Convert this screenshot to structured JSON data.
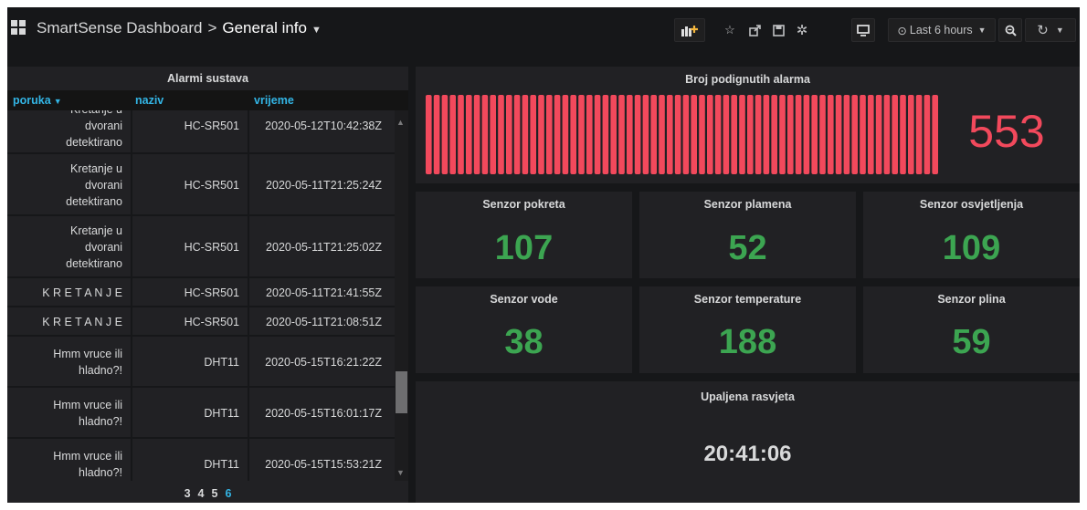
{
  "breadcrumb": {
    "root": "SmartSense Dashboard",
    "separator": ">",
    "current": "General info"
  },
  "toolbar": {
    "time_range": "Last 6 hours"
  },
  "alarms_table": {
    "title": "Alarmi sustava",
    "columns": [
      "poruka",
      "naziv",
      "vrijeme"
    ],
    "rows": [
      {
        "poruka": [
          "Kretanje u",
          "dvorani",
          "detektirano"
        ],
        "naziv": "HC-SR501",
        "vrijeme": "2020-05-12T10:42:38Z"
      },
      {
        "poruka": [
          "Kretanje u",
          "dvorani",
          "detektirano"
        ],
        "naziv": "HC-SR501",
        "vrijeme": "2020-05-11T21:25:24Z"
      },
      {
        "poruka": [
          "Kretanje u",
          "dvorani",
          "detektirano"
        ],
        "naziv": "HC-SR501",
        "vrijeme": "2020-05-11T21:25:02Z"
      },
      {
        "poruka": [
          "K R E T A N J E"
        ],
        "naziv": "HC-SR501",
        "vrijeme": "2020-05-11T21:41:55Z"
      },
      {
        "poruka": [
          "K R E T A N J E"
        ],
        "naziv": "HC-SR501",
        "vrijeme": "2020-05-11T21:08:51Z"
      },
      {
        "poruka": [
          "Hmm vruce ili",
          "hladno?!"
        ],
        "naziv": "DHT11",
        "vrijeme": "2020-05-15T16:21:22Z"
      },
      {
        "poruka": [
          "Hmm vruce ili",
          "hladno?!"
        ],
        "naziv": "DHT11",
        "vrijeme": "2020-05-15T16:01:17Z"
      },
      {
        "poruka": [
          "Hmm vruce ili",
          "hladno?!"
        ],
        "naziv": "DHT11",
        "vrijeme": "2020-05-15T15:53:21Z"
      }
    ],
    "pages": [
      "3",
      "4",
      "5",
      "6"
    ],
    "active_page": "6"
  },
  "alarm_count_panel": {
    "title": "Broj podignutih alarma",
    "value": "553",
    "bar_count": 64,
    "bar_color": "#f2495c"
  },
  "stats": [
    {
      "title": "Senzor pokreta",
      "value": "107"
    },
    {
      "title": "Senzor plamena",
      "value": "52"
    },
    {
      "title": "Senzor osvjetljenja",
      "value": "109"
    },
    {
      "title": "Senzor vode",
      "value": "38"
    },
    {
      "title": "Senzor temperature",
      "value": "188"
    },
    {
      "title": "Senzor plina",
      "value": "59"
    }
  ],
  "lights_panel": {
    "title": "Upaljena rasvjeta",
    "value": "20:41:06"
  },
  "colors": {
    "background": "#161719",
    "panel": "#212124",
    "accent": "#33b5e5",
    "stat_green": "#3ca551",
    "alarm_red": "#f2495c"
  }
}
